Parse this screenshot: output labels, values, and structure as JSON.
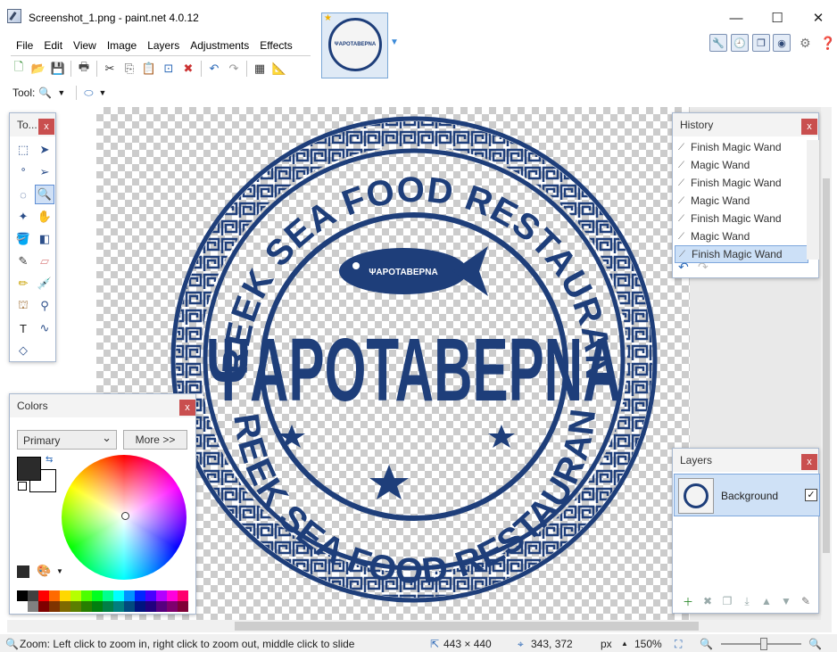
{
  "window": {
    "title": "Screenshot_1.png - paint.net 4.0.12",
    "min_label": "—",
    "max_label": "☐",
    "close_label": "✕"
  },
  "thumbnail": {
    "label": "ΨΑΡΟΤΑΒΕΡΝΑ"
  },
  "menu": [
    "File",
    "Edit",
    "View",
    "Image",
    "Layers",
    "Adjustments",
    "Effects"
  ],
  "toolbar": {
    "tool_label": "Tool:"
  },
  "stamp": {
    "top_text": "GREEK SEA FOOD RESTAURANT",
    "center_text": "ΨΑΡΟΤΑΒΕΡΝΑ",
    "bottom_text": "GREEK SEA FOOD RESTAURANT",
    "color": "#1e3e7a"
  },
  "tools_panel": {
    "title": "To...",
    "close": "x"
  },
  "history_panel": {
    "title": "History",
    "close": "x",
    "items": [
      {
        "label": "Finish Magic Wand",
        "selected": false
      },
      {
        "label": "Magic Wand",
        "selected": false
      },
      {
        "label": "Finish Magic Wand",
        "selected": false
      },
      {
        "label": "Magic Wand",
        "selected": false
      },
      {
        "label": "Finish Magic Wand",
        "selected": false
      },
      {
        "label": "Magic Wand",
        "selected": false
      },
      {
        "label": "Finish Magic Wand",
        "selected": true
      }
    ]
  },
  "layers_panel": {
    "title": "Layers",
    "close": "x",
    "layers": [
      {
        "name": "Background",
        "visible": true
      }
    ]
  },
  "colors_panel": {
    "title": "Colors",
    "close": "x",
    "mode_select": "Primary",
    "more_button": "More >>",
    "primary_color": "#2b2b2b",
    "secondary_color": "#ffffff"
  },
  "statusbar": {
    "hint": "Zoom: Left click to zoom in, right click to zoom out, middle click to slide",
    "image_size": "443 × 440",
    "cursor_pos": "343, 372",
    "units": "px",
    "zoom": "150%"
  }
}
